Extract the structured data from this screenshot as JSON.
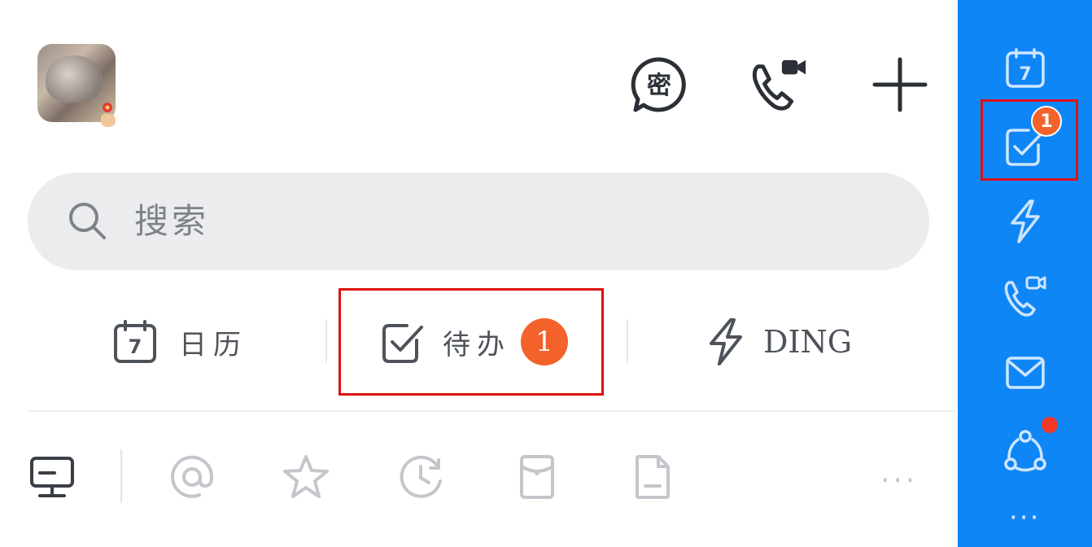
{
  "header": {
    "avatar_alt": "user avatar",
    "icons": [
      "secret-chat-icon",
      "video-call-icon",
      "plus-icon"
    ],
    "secret_chat_glyph": "密"
  },
  "search": {
    "placeholder": "搜索"
  },
  "tabs": [
    {
      "label": "日历",
      "icon": "calendar-icon",
      "calendar_day": "7"
    },
    {
      "label": "待办",
      "icon": "todo-check-icon",
      "badge": "1"
    },
    {
      "label": "DING",
      "icon": "ding-lightning-icon"
    }
  ],
  "filters": [
    "desktop-icon",
    "mention-icon",
    "star-icon",
    "recent-clock-icon",
    "red-packet-icon",
    "document-icon"
  ],
  "filters_more": "···",
  "rail": {
    "calendar_day": "7",
    "todo_badge": "1",
    "more": "···",
    "icons": [
      "calendar-icon",
      "todo-check-icon",
      "ding-lightning-icon",
      "video-call-icon",
      "mail-icon",
      "network-icon"
    ]
  },
  "colors": {
    "rail_bg": "#0e86f6",
    "badge": "#f3622b",
    "highlight": "#e01010"
  }
}
